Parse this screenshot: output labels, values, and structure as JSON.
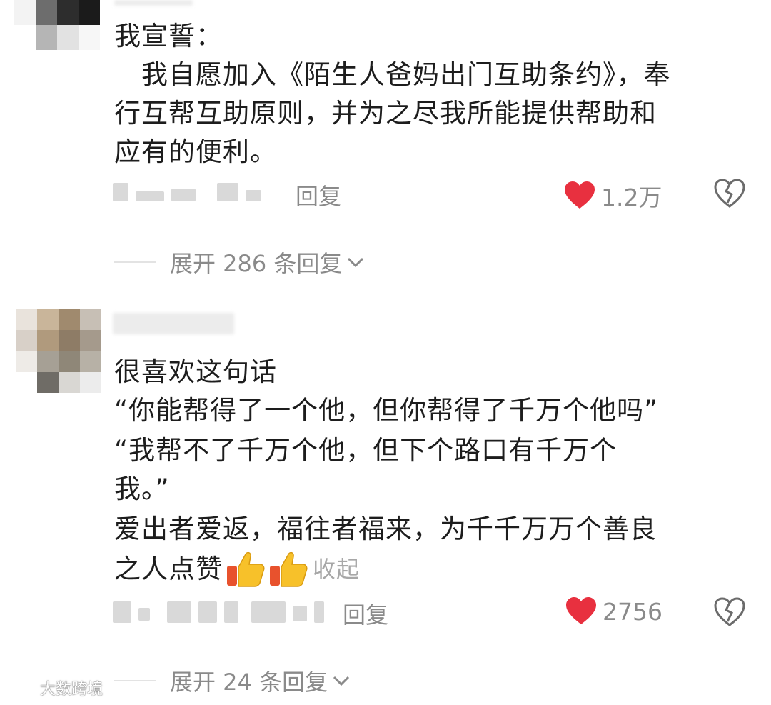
{
  "comments": [
    {
      "lines": [
        "我宣誓：",
        "　我自愿加入《陌生人爸妈出门互助条约》，奉",
        "行互帮互助原则，并为之尽我所能提供帮助和",
        "应有的便利。"
      ],
      "reply_label": "回复",
      "likes": "1.2万",
      "expand_label": "展开 286 条回复"
    },
    {
      "lines": [
        "很喜欢这句话",
        "“你能帮得了一个他，但你帮得了千万个他吗”",
        "“我帮不了千万个他，但下个路口有千万个",
        "我。”",
        "爱出者爱返，福往者福来，为千千万万个善良",
        "之人点赞"
      ],
      "collapse_label": "收起",
      "reply_label": "回复",
      "likes": "2756",
      "expand_label": "展开 24 条回复"
    }
  ],
  "watermark": "大数跨境",
  "colors": {
    "heart": "#e8303f",
    "muted_text": "#8a8a8a",
    "body_text": "#1d1d1d"
  },
  "icons": [
    "heart-icon",
    "broken-heart-icon",
    "chevron-down-icon",
    "thumbs-up-icon"
  ]
}
